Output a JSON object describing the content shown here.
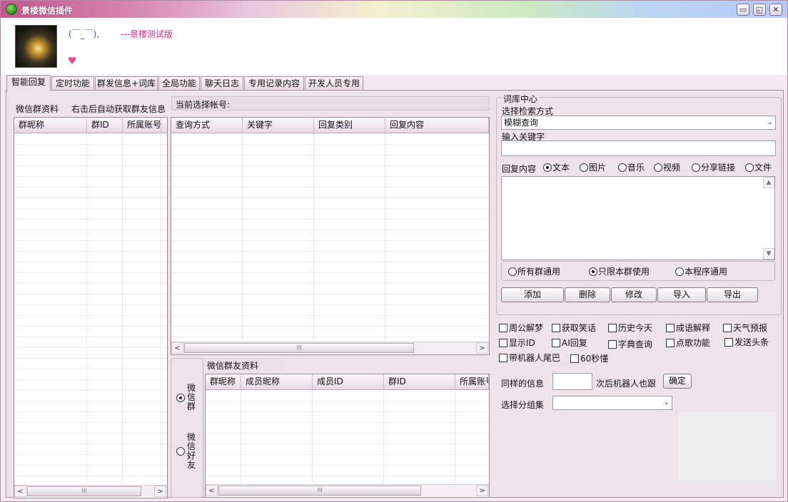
{
  "window": {
    "title": "景楼微信插件",
    "controls": {
      "minimize": "▭",
      "restore": "◱",
      "close": "✕"
    }
  },
  "profile": {
    "nickname": "(￣_￣),",
    "version": "---景楼测试版",
    "heart_glyph": "♥"
  },
  "tabs": [
    "智能回复",
    "定时功能",
    "群发信息+词库",
    "全局功能",
    "聊天日志",
    "专用记录内容",
    "开发人员专用"
  ],
  "left": {
    "title": "微信群资料",
    "hint": "右击后自动获取群友信息",
    "columns": [
      "群昵称",
      "群ID",
      "所属账号"
    ]
  },
  "middle": {
    "current_account_label": "当前选择帐号:",
    "columns": [
      "查询方式",
      "关键字",
      "回复类别",
      "回复内容"
    ]
  },
  "member_section": {
    "title": "微信群友资料",
    "radio_group": "微信群",
    "radio_friend": "微信好友",
    "columns": [
      "群昵称",
      "成员昵称",
      "成员ID",
      "群ID",
      "所属账号"
    ]
  },
  "lexicon": {
    "group_title": "词库中心",
    "search_mode_label": "选择检索方式",
    "search_mode_value": "模糊查询",
    "keyword_label": "输入关键字",
    "reply_label": "回复内容",
    "reply_types": [
      "文本",
      "图片",
      "音乐",
      "视频",
      "分享链接",
      "文件"
    ],
    "reply_type_selected": "文本",
    "scope_options": [
      "所有群通用",
      "只限本群使用",
      "本程序通用"
    ],
    "scope_selected": "只限本群使用",
    "buttons": [
      "添加",
      "删除",
      "修改",
      "导入",
      "导出"
    ]
  },
  "features": {
    "row1": [
      "周公解梦",
      "获取笑话",
      "历史今天",
      "成语解释",
      "天气预报"
    ],
    "row2": [
      "显示ID",
      "AI回复",
      "字典查询",
      "点歌功能",
      "发送头条"
    ],
    "row3": [
      "带机器人尾巴",
      "60秒懂"
    ]
  },
  "follow": {
    "label_before": "同样的信息",
    "label_after": "次后机器人也跟",
    "confirm": "确定",
    "group_label": "选择分组集"
  },
  "scroll_glyphs": {
    "left": "<",
    "right": ">",
    "up": "▲",
    "down": "▼",
    "grip": "III",
    "caret": "⌄"
  }
}
